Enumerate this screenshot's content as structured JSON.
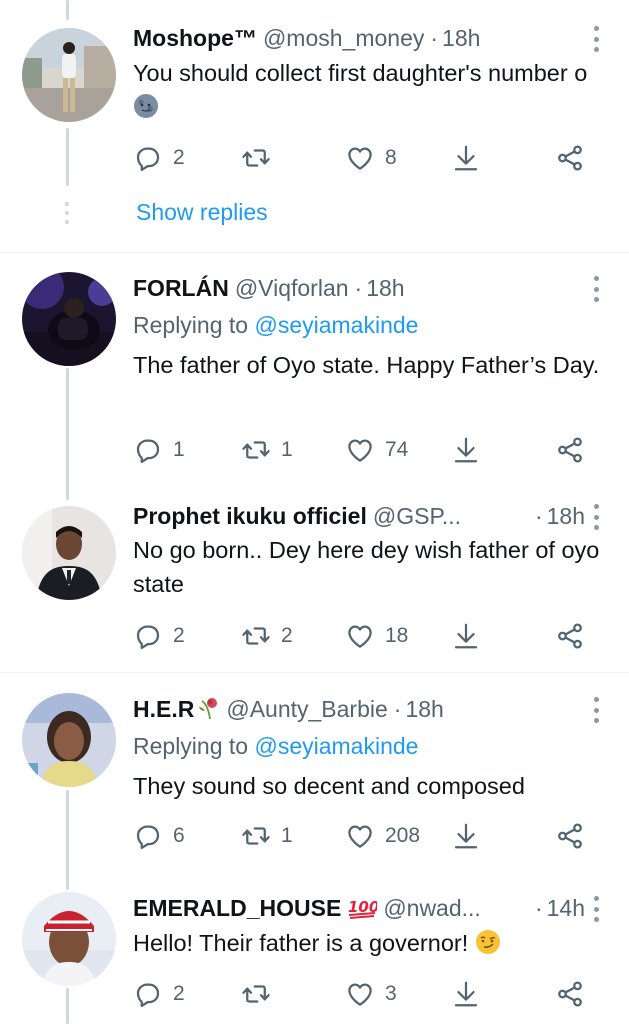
{
  "tweets": [
    {
      "name": "Moshope™",
      "handle": "@mosh_money",
      "time": "18h",
      "replying_prefix": "",
      "replying_to": "",
      "text": "You should collect first daughter's number o",
      "emoji": "moon-face",
      "replies": "2",
      "retweets": "",
      "likes": "8"
    },
    {
      "name": "FORLÁN",
      "handle": "@Viqforlan",
      "time": "18h",
      "replying_prefix": "Replying to",
      "replying_to": "@seyiamakinde",
      "text": "The father of Oyo state. Happy Father’s Day.",
      "replies": "1",
      "retweets": "1",
      "likes": "74"
    },
    {
      "name": "Prophet ikuku officiel",
      "handle": "@GSP...",
      "time": "18h",
      "text": "No go born.. Dey here dey wish father of oyo state",
      "replies": "2",
      "retweets": "2",
      "likes": "18"
    },
    {
      "name": "H.E.R",
      "name_emoji": "wilted-rose",
      "handle": "@Aunty_Barbie",
      "time": "18h",
      "replying_prefix": "Replying to",
      "replying_to": "@seyiamakinde",
      "text": "They sound so decent and composed",
      "replies": "6",
      "retweets": "1",
      "likes": "208"
    },
    {
      "name": "EMERALD_HOUSE",
      "name_emoji": "hundred-points",
      "handle": "@nwad...",
      "time": "14h",
      "text": "Hello! Their father is a governor!",
      "emoji": "smirking-face",
      "replies": "2",
      "retweets": "",
      "likes": "3"
    }
  ],
  "show_replies_label": "Show replies",
  "separator": "·",
  "icons": [
    "reply-icon",
    "retweet-icon",
    "like-icon",
    "bookmark-download-icon",
    "share-icon",
    "more-icon"
  ],
  "colors": {
    "accent": "#1d9bf0",
    "muted": "#536471",
    "text": "#0f1419",
    "thread": "#cfd9de"
  }
}
